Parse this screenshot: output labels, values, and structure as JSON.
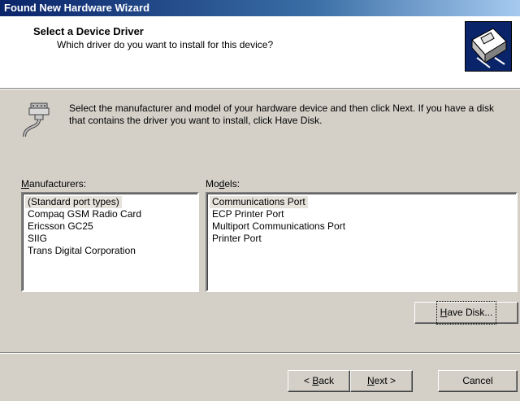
{
  "window": {
    "title": "Found New Hardware Wizard"
  },
  "header": {
    "title": "Select a Device Driver",
    "subtitle": "Which driver do you want to install for this device?"
  },
  "instructions": "Select the manufacturer and model of your hardware device and then click Next. If you have a disk that contains the driver you want to install, click Have Disk.",
  "manufacturers": {
    "label_prefix": "",
    "label_key": "M",
    "label_rest": "anufacturers:",
    "items": [
      "(Standard port types)",
      "Compaq GSM Radio Card",
      "Ericsson GC25",
      "SIIG",
      "Trans Digital Corporation"
    ],
    "selected": "(Standard port types)"
  },
  "models": {
    "label_prefix": "Mo",
    "label_key": "d",
    "label_rest": "els:",
    "items": [
      "Communications Port",
      "ECP Printer Port",
      "Multiport Communications Port",
      "Printer Port"
    ],
    "selected": "Communications Port"
  },
  "buttons": {
    "have_disk": {
      "key": "H",
      "rest": "ave Disk..."
    },
    "back": {
      "prefix": "< ",
      "key": "B",
      "rest": "ack"
    },
    "next": {
      "key": "N",
      "rest": "ext >"
    },
    "cancel": "Cancel"
  },
  "colors": {
    "titlebar_start": "#0a246a",
    "dialog_face": "#d4d0c8",
    "selection": "#e6e3dc"
  },
  "icons": {
    "wizard": "hardware-card-icon",
    "connector": "serial-connector-icon"
  }
}
